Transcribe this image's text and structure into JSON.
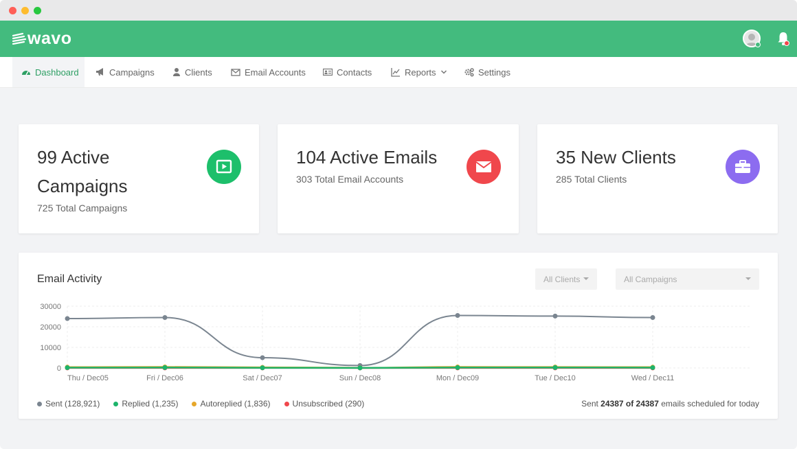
{
  "app": {
    "name": "wavo"
  },
  "colors": {
    "brand": "#43bb7e",
    "sent": "#7a8590",
    "replied": "#1db46b",
    "autoreplied": "#e6a72a",
    "unsubscribed": "#f0474c",
    "campaigns_icon": "#1dbf6b",
    "emails_icon": "#f0474c",
    "clients_icon": "#8c6cf0"
  },
  "header": {
    "avatar_icon": "user-avatar-icon",
    "bell_icon": "bell-icon"
  },
  "nav": [
    {
      "label": "Dashboard",
      "icon": "dashboard-icon",
      "active": true
    },
    {
      "label": "Campaigns",
      "icon": "megaphone-icon"
    },
    {
      "label": "Clients",
      "icon": "user-icon"
    },
    {
      "label": "Email Accounts",
      "icon": "envelope-icon"
    },
    {
      "label": "Contacts",
      "icon": "id-card-icon"
    },
    {
      "label": "Reports",
      "icon": "line-chart-icon"
    },
    {
      "label": "Settings",
      "icon": "gears-icon"
    }
  ],
  "stats": {
    "campaigns": {
      "line1": "99 Active",
      "line2": "Campaigns",
      "sub": "725 Total Campaigns",
      "icon": "play-icon"
    },
    "emails": {
      "title": "104 Active Emails",
      "sub": "303 Total Email Accounts",
      "icon": "envelope-icon"
    },
    "clients": {
      "title": "35 New Clients",
      "sub": "285 Total Clients",
      "icon": "briefcase-icon"
    }
  },
  "activity": {
    "title": "Email Activity",
    "filter_clients": "All Clients",
    "filter_campaigns": "All Campaigns",
    "legend": {
      "sent": "Sent (128,921)",
      "replied": "Replied (1,235)",
      "autoreplied": "Autoreplied (1,836)",
      "unsubscribed": "Unsubscribed (290)"
    },
    "schedule": {
      "prefix": "Sent",
      "count": "24387 of 24387",
      "suffix": "emails scheduled for today"
    }
  },
  "chart_data": {
    "type": "line",
    "categories": [
      "Thu / Dec05",
      "Fri / Dec06",
      "Sat / Dec07",
      "Sun / Dec08",
      "Mon / Dec09",
      "Tue / Dec10",
      "Wed / Dec11"
    ],
    "ylim": [
      0,
      30000
    ],
    "yticks": [
      "30000",
      "20000",
      "10000",
      "0"
    ],
    "grid": true,
    "series": [
      {
        "name": "Sent",
        "color": "#7a8590",
        "values": [
          24000,
          24500,
          5000,
          1200,
          25500,
          25200,
          24500
        ]
      },
      {
        "name": "Replied",
        "color": "#1db46b",
        "values": [
          150,
          200,
          100,
          50,
          220,
          200,
          180
        ]
      },
      {
        "name": "Autoreplied",
        "color": "#e6a72a",
        "values": [
          400,
          500,
          300,
          100,
          500,
          450,
          400
        ]
      },
      {
        "name": "Unsubscribed",
        "color": "#f0474c",
        "values": [
          40,
          50,
          30,
          20,
          50,
          40,
          40
        ]
      }
    ]
  }
}
